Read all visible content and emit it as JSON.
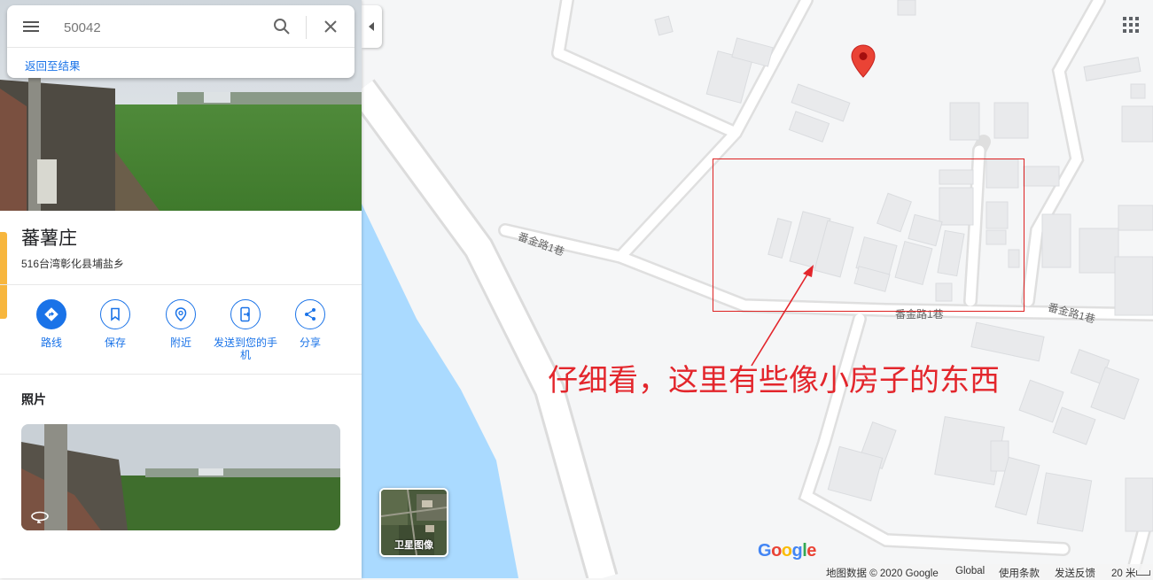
{
  "search": {
    "value": "50042"
  },
  "nav": {
    "back_label": "返回至结果"
  },
  "place": {
    "name": "蕃薯庄",
    "address": "516台湾彰化县埔盐乡"
  },
  "actions": [
    {
      "label": "路线",
      "icon": "directions-icon"
    },
    {
      "label": "保存",
      "icon": "bookmark-icon"
    },
    {
      "label": "附近",
      "icon": "nearby-icon"
    },
    {
      "label": "发送到您的手机",
      "icon": "send-to-phone-icon"
    },
    {
      "label": "分享",
      "icon": "share-icon"
    }
  ],
  "photos": {
    "heading": "照片"
  },
  "map": {
    "roads": [
      "番金路1巷",
      "番金路1巷",
      "番金路1巷"
    ],
    "satellite_label": "卫星图像",
    "logo": "Google",
    "footer": {
      "data": "地图数据 © 2020 Google",
      "region": "Global",
      "terms": "使用条款",
      "feedback": "发送反馈",
      "scale": "20 米"
    }
  },
  "annotation": {
    "text": "仔细看，这里有些像小房子的东西"
  },
  "colors": {
    "accent": "#1a73e8",
    "marker": "#ea4335",
    "annotation": "#e3262c",
    "water": "#aadaff",
    "highlight": "#f7b63d"
  }
}
